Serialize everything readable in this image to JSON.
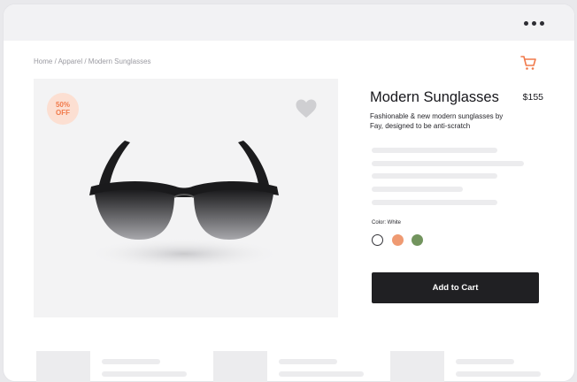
{
  "breadcrumb": "Home / Apparel / Modern Sunglasses",
  "icons": {
    "more": "more-horizontal-icon",
    "cart": "shopping-cart-icon",
    "favorite": "heart-icon"
  },
  "product": {
    "badge_line1": "50%",
    "badge_line2": "OFF",
    "title": "Modern Sunglasses",
    "price": "$155",
    "description": "Fashionable & new modern sunglasses by Fay, designed to be anti-scratch",
    "color_label": "Color: White",
    "colors": [
      {
        "name": "White",
        "hex": "#ffffff",
        "selected": true
      },
      {
        "name": "Orange",
        "hex": "#ef9a72",
        "selected": false
      },
      {
        "name": "Green",
        "hex": "#72945e",
        "selected": false
      }
    ],
    "add_to_cart": "Add to Cart"
  },
  "theme": {
    "accent": "#f17a4b",
    "button_bg": "#202023"
  }
}
